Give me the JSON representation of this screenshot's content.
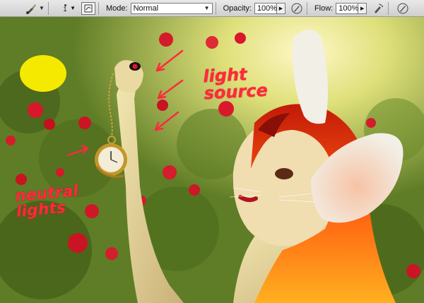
{
  "options_bar": {
    "brush_size": "1",
    "mode_label": "Mode:",
    "mode_value": "Normal",
    "opacity_label": "Opacity:",
    "opacity_value": "100%",
    "flow_label": "Flow:",
    "flow_value": "100%",
    "icons": [
      "brush-preset-icon",
      "toggle-brush-panel-icon",
      "tablet-pressure-opacity-icon",
      "airbrush-icon",
      "tablet-pressure-size-icon"
    ]
  },
  "canvas": {
    "annotations": {
      "light_source_line1": "light",
      "light_source_line2": "source",
      "neutral_lights_line1": "neutral",
      "neutral_lights_line2": "lights"
    },
    "colors": {
      "annotation": "#ff2a3c",
      "light_spot": "#f5e900",
      "foliage": "#4d6b1f"
    }
  }
}
